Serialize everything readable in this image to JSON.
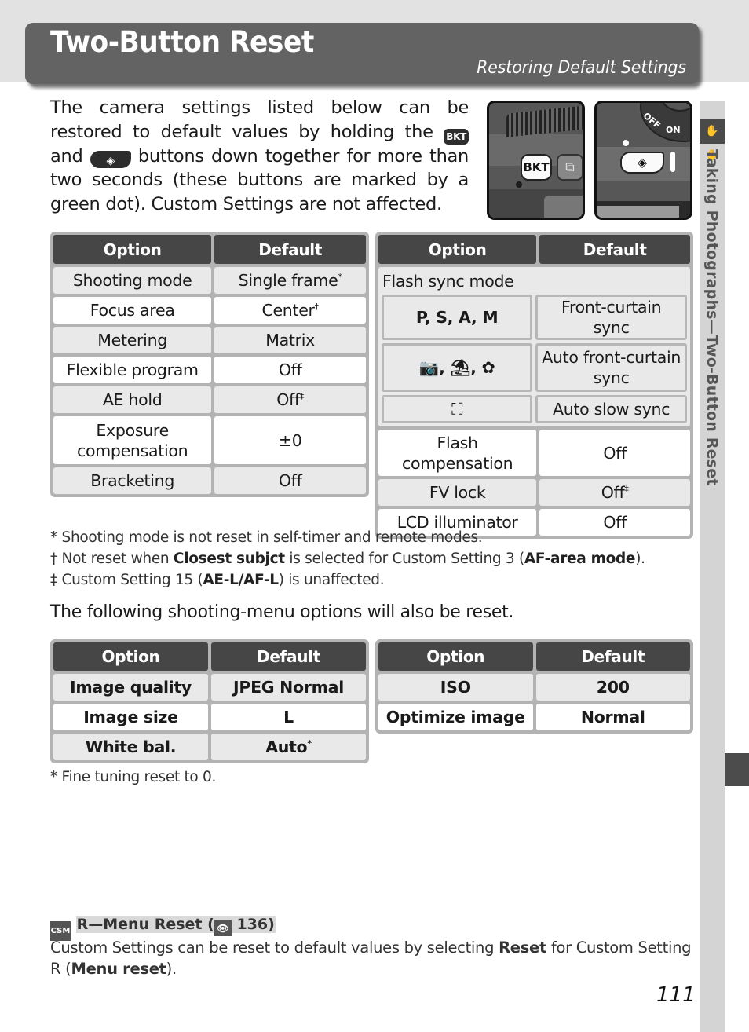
{
  "header": {
    "title": "Two-Button Reset",
    "subtitle": "Restoring Default Settings"
  },
  "intro": {
    "text_1": "The camera settings listed below can be restored to default values by holding the ",
    "button_1": "BKT",
    "text_2": " and ",
    "button_2": "AE-button-icon",
    "text_3": " buttons down together for more than two seconds (these buttons are marked by a green dot).  Custom Settings are not affected."
  },
  "photos": {
    "bkt_label": "BKT",
    "drive_glyph": "⧉",
    "off_label": "OFF",
    "on_label": "ON",
    "ae_glyph": "◈"
  },
  "side_tab": {
    "icon": "two-hands-icon",
    "label": "Taking Photographs—Two-Button Reset"
  },
  "table_headers": {
    "option": "Option",
    "default": "Default"
  },
  "table_left": [
    {
      "option": "Shooting mode",
      "default": "Single frame",
      "mark": "*"
    },
    {
      "option": "Focus area",
      "default": "Center",
      "mark": "†"
    },
    {
      "option": "Metering",
      "default": "Matrix",
      "mark": ""
    },
    {
      "option": "Flexible program",
      "default": "Off",
      "mark": ""
    },
    {
      "option": "AE hold",
      "default": "Off",
      "mark": "‡"
    },
    {
      "option": "Exposure compensation",
      "default": "±0",
      "mark": ""
    },
    {
      "option": "Bracketing",
      "default": "Off",
      "mark": ""
    }
  ],
  "table_right": {
    "flash_sync": {
      "label": "Flash sync mode",
      "rows": [
        {
          "mode": "P, S, A, M",
          "default": "Front-curtain sync"
        },
        {
          "mode": "AUTO, portrait, close-up",
          "mode_glyphs": "📷, ⛱, ✿",
          "default": "Auto front-curtain sync"
        },
        {
          "mode": "night portrait",
          "mode_glyphs": "⛶",
          "default": "Auto slow sync"
        }
      ]
    },
    "rows": [
      {
        "option": "Flash compensation",
        "default": "Off",
        "mark": ""
      },
      {
        "option": "FV lock",
        "default": "Off",
        "mark": "‡"
      },
      {
        "option": "LCD illuminator",
        "default": "Off",
        "mark": ""
      }
    ]
  },
  "notes": [
    {
      "mark": "*",
      "text": "Shooting mode is not reset in self-timer and remote modes."
    },
    {
      "mark": "†",
      "pre": "Not reset when ",
      "bold1": "Closest subjct",
      "mid": " is selected for Custom Setting 3 (",
      "bold2": "AF-area mode",
      "post": ")."
    },
    {
      "mark": "‡",
      "pre": "Custom Setting 15 (",
      "bold1": "AE-L/AF-L",
      "post": ") is unaffected."
    }
  ],
  "lead_text": "The following shooting-menu options will also be reset.",
  "shooting_menu_left": [
    {
      "option": "Image quality",
      "default": "JPEG Normal",
      "mark": ""
    },
    {
      "option": "Image size",
      "default": "L",
      "mark": ""
    },
    {
      "option": "White bal.",
      "default": "Auto",
      "mark": "*"
    }
  ],
  "shooting_menu_right": [
    {
      "option": "ISO",
      "default": "200"
    },
    {
      "option": "Optimize image",
      "default": "Normal"
    }
  ],
  "fine_note": "* Fine tuning reset to 0.",
  "tip": {
    "icon": "CSM",
    "title_pre": "R—Menu Reset (",
    "ref_icon": "eye-reference-icon",
    "ref_page": "136",
    "title_post": ")",
    "body_pre": "Custom Settings can be reset to default values by selecting ",
    "body_bold1": "Reset",
    "body_mid": " for Custom Setting R (",
    "body_bold2": "Menu reset",
    "body_post": ")."
  },
  "page_number": "111"
}
